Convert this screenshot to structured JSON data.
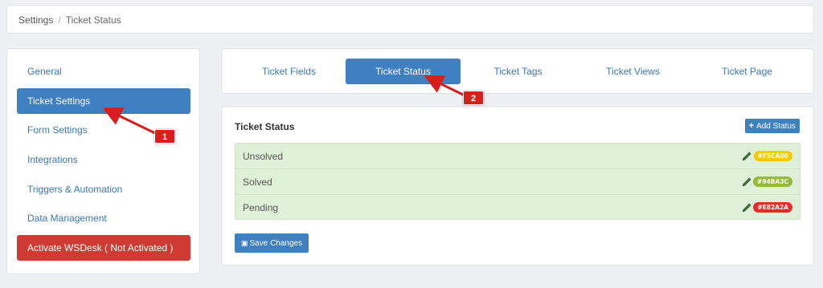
{
  "breadcrumb": {
    "root": "Settings",
    "separator": "/",
    "current": "Ticket Status"
  },
  "sidebar": {
    "items": [
      {
        "label": "General"
      },
      {
        "label": "Ticket Settings"
      },
      {
        "label": "Form Settings"
      },
      {
        "label": "Integrations"
      },
      {
        "label": "Triggers & Automation"
      },
      {
        "label": "Data Management"
      }
    ],
    "activate_label": "Activate WSDesk ( Not Activated )"
  },
  "tabs": [
    {
      "label": "Ticket Fields"
    },
    {
      "label": "Ticket Status"
    },
    {
      "label": "Ticket Tags"
    },
    {
      "label": "Ticket Views"
    },
    {
      "label": "Ticket Page"
    }
  ],
  "status_panel": {
    "title": "Ticket Status",
    "add_button": "Add Status",
    "rows": [
      {
        "name": "Unsolved",
        "color_label": "#F5CA00",
        "color": "#f5ca00",
        "icon": "pencil-icon"
      },
      {
        "name": "Solved",
        "color_label": "#94BA3C",
        "color": "#94ba3c",
        "icon": "pencil-icon"
      },
      {
        "name": "Pending",
        "color_label": "#E82A2A",
        "color": "#e82a2a",
        "icon": "pencil-icon"
      }
    ],
    "save_button": "Save Changes"
  },
  "annotations": [
    {
      "label": "1"
    },
    {
      "label": "2"
    }
  ],
  "colors": {
    "accent": "#3f80c2",
    "danger": "#cf3a32",
    "status_bg": "#dff0d8",
    "annotation": "#d91e1e"
  }
}
